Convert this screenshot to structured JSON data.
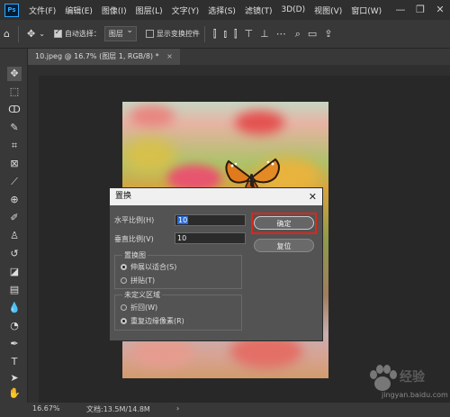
{
  "menubar": {
    "logo": "Ps",
    "items": [
      "文件(F)",
      "编辑(E)",
      "图像(I)",
      "图层(L)",
      "文字(Y)",
      "选择(S)",
      "滤镜(T)",
      "3D(D)",
      "视图(V)",
      "窗口(W)"
    ],
    "window_controls": [
      "—",
      "❐",
      "✕"
    ]
  },
  "optbar": {
    "auto_select_label": "自动选择：",
    "auto_select_checked": true,
    "auto_select_value": "图层",
    "show_transform_label": "显示变换控件",
    "show_transform_checked": false
  },
  "tab": {
    "label": "10.jpeg @ 16.7% (图层 1, RGB/8) *",
    "close": "×"
  },
  "status": {
    "zoom": "16.67%",
    "doc": "文档:13.5M/14.8M"
  },
  "dialog": {
    "title": "置换",
    "close": "✕",
    "horizontal_label": "水平比例(H)",
    "horizontal_value": "10",
    "vertical_label": "垂直比例(V)",
    "vertical_value": "10",
    "map_group": {
      "legend": "置换图",
      "options": [
        "伸展以适合(S)",
        "拼贴(T)"
      ],
      "selected": 0
    },
    "undefined_group": {
      "legend": "未定义区域",
      "options": [
        "折回(W)",
        "重复边缘像素(R)"
      ],
      "selected": 1
    },
    "ok_label": "确定",
    "reset_label": "复位"
  },
  "watermark": {
    "brand": "经验",
    "url": "jingyan.baidu.com"
  },
  "colors": {
    "highlight": "#e0251b",
    "selection": "#2a6ad6",
    "ps_blue": "#31a8ff"
  }
}
